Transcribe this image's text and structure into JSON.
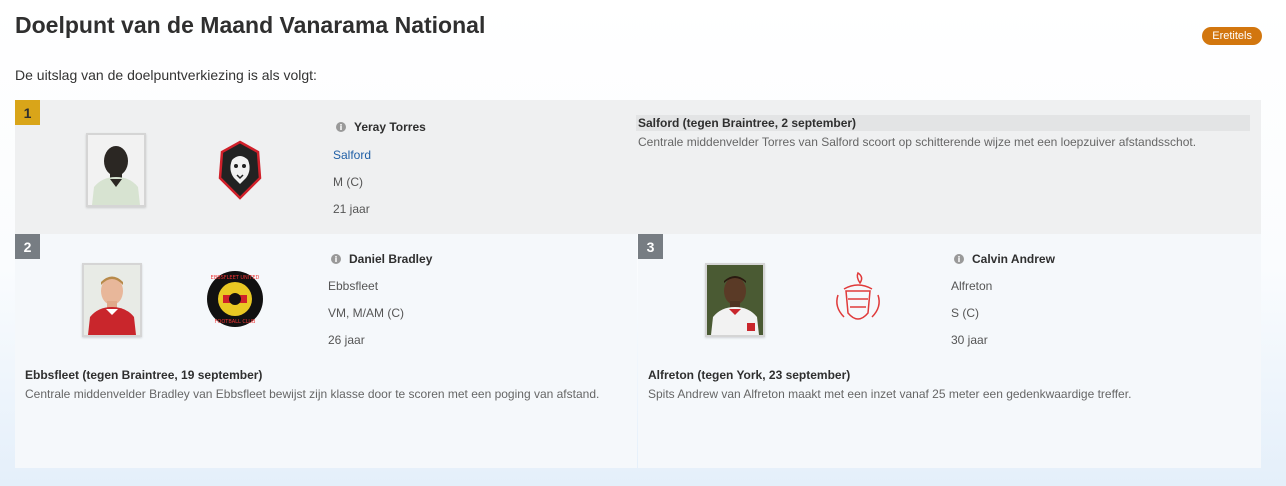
{
  "header": {
    "title": "Doelpunt van de Maand Vanarama National",
    "badge": "Eretitels"
  },
  "intro": "De uitslag van de doelpuntverkiezing is als volgt:",
  "colors": {
    "gold": "#d9a519",
    "grey": "#777d83",
    "badge": "#d2760e",
    "link": "#1f5fa6"
  },
  "entries": [
    {
      "rank": "1",
      "player": "Yeray Torres",
      "club": "Salford",
      "position": "M (C)",
      "age": "21 jaar",
      "goal_title": "Salford (tegen Braintree, 2 september)",
      "goal_desc": "Centrale middenvelder Torres van Salford scoort op schitterende wijze met een loepzuiver afstandsschot.",
      "crest_icon": "salford-lion-crest-icon"
    },
    {
      "rank": "2",
      "player": "Daniel Bradley",
      "club": "Ebbsfleet",
      "position": "VM, M/AM (C)",
      "age": "26 jaar",
      "goal_title": "Ebbsfleet (tegen Braintree, 19 september)",
      "goal_desc": "Centrale middenvelder Bradley van Ebbsfleet bewijst zijn klasse door te scoren met een poging van afstand.",
      "crest_icon": "ebbsfleet-united-crest-icon",
      "crest_text_top": "EBBSFLEET UNITED",
      "crest_text_bottom": "FOOTBALL CLUB"
    },
    {
      "rank": "3",
      "player": "Calvin Andrew",
      "club": "Alfreton",
      "position": "S (C)",
      "age": "30 jaar",
      "goal_title": "Alfreton (tegen York, 23 september)",
      "goal_desc": "Spits Andrew van Alfreton maakt met een inzet vanaf 25 meter een gedenkwaardige treffer.",
      "crest_icon": "alfreton-crest-icon"
    }
  ],
  "info_icon": "i"
}
